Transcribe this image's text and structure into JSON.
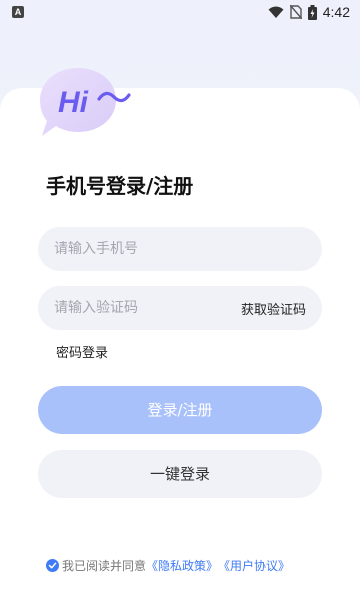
{
  "status_bar": {
    "app_icon_letter": "A",
    "time": "4:42"
  },
  "hero": {
    "greeting": "Hi"
  },
  "title": "手机号登录/注册",
  "phone_input": {
    "placeholder": "请输入手机号",
    "value": ""
  },
  "code_input": {
    "placeholder": "请输入验证码",
    "value": "",
    "get_code_label": "获取验证码"
  },
  "password_login_label": "密码登录",
  "primary_button_label": "登录/注册",
  "one_click_button_label": "一键登录",
  "agreement": {
    "checked": true,
    "prefix": "我已阅读并同意",
    "privacy_link": "《隐私政策》",
    "terms_link": "《用户协议》"
  },
  "colors": {
    "accent": "#3f7bf6",
    "primary_button": "#a9c1fb",
    "field_bg": "#f1f2f7",
    "hi_text": "#6b5cf0"
  }
}
